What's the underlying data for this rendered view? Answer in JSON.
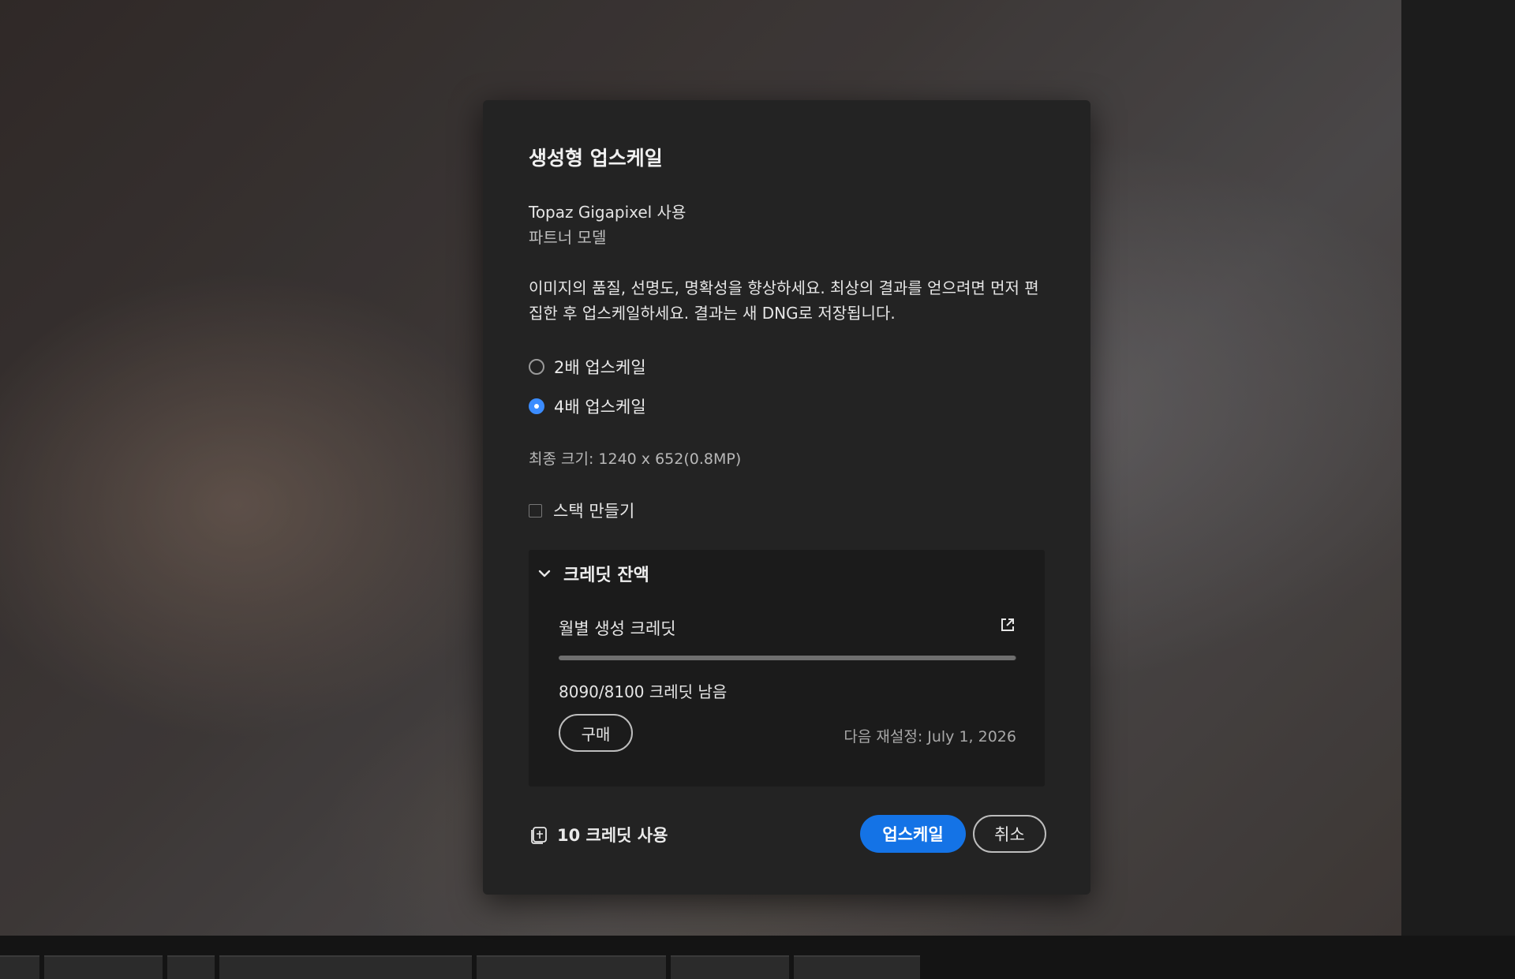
{
  "dialog": {
    "title": "생성형 업스케일",
    "model_name": "Topaz Gigapixel 사용",
    "model_subtitle": "파트너 모델",
    "description": "이미지의 품질, 선명도, 명확성을 향상하세요. 최상의 결과를 얻으려면 먼저 편집한 후 업스케일하세요. 결과는 새 DNG로 저장됩니다.",
    "options": [
      {
        "label": "2배 업스케일",
        "checked": false
      },
      {
        "label": "4배 업스케일",
        "checked": true
      }
    ],
    "final_size": "최종 크기: 1240 x 652(0.8MP)",
    "stack_label": "스택 만들기",
    "stack_checked": false
  },
  "credits": {
    "section_title": "크레딧 잔액",
    "monthly_label": "월별 생성 크레딧",
    "remaining_text": "8090/8100 크레딧 남음",
    "remaining_fraction": 0.9988,
    "buy_label": "구매",
    "reset_text": "다음 재설정: July 1, 2026"
  },
  "footer": {
    "credit_use": "10 크레딧 사용",
    "upscale_label": "업스케일",
    "cancel_label": "취소"
  },
  "colors": {
    "accent": "#1473e6",
    "radio_checked": "#3b8cff",
    "dialog_bg": "#232323"
  }
}
